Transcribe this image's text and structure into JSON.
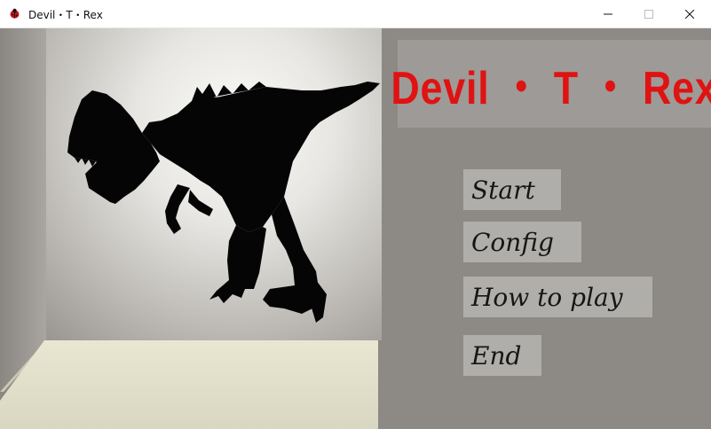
{
  "window": {
    "title": "Devil・T・Rex",
    "icon": "red-beetle-icon",
    "controls": [
      "minimize-icon",
      "maximize-icon",
      "close-icon"
    ]
  },
  "game": {
    "title": "Devil ・ T ・ Rex",
    "title_color": "#e01212",
    "menu": {
      "start": "Start",
      "config": "Config",
      "how_to_play": "How to play",
      "end": "End"
    }
  }
}
